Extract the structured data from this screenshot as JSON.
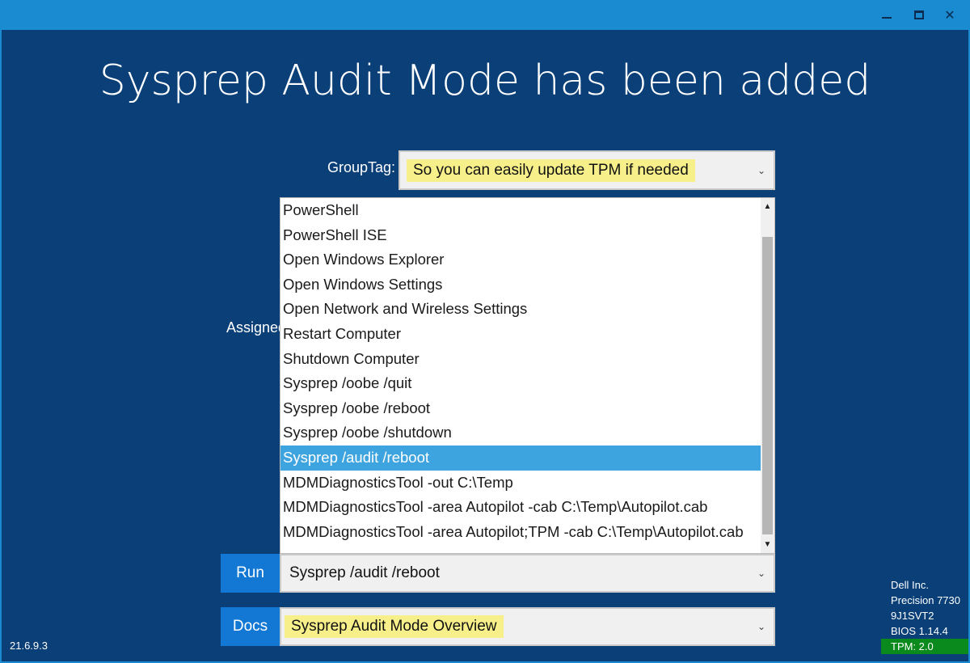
{
  "window": {
    "controls": [
      "minimize",
      "maximize",
      "close"
    ],
    "close_glyph": "✕"
  },
  "heading": "Sysprep Audit Mode has been added",
  "group_tag": {
    "label": "GroupTag:",
    "value": "So you can easily update TPM if needed"
  },
  "assigned_label_partial": "Assigned",
  "dropdown_list": {
    "items": [
      "PowerShell",
      "PowerShell ISE",
      "Open Windows Explorer",
      "Open Windows Settings",
      "Open Network and Wireless Settings",
      "Restart Computer",
      "Shutdown Computer",
      "Sysprep /oobe /quit",
      "Sysprep /oobe /reboot",
      "Sysprep /oobe /shutdown",
      "Sysprep /audit /reboot",
      "MDMDiagnosticsTool -out C:\\Temp",
      "MDMDiagnosticsTool -area Autopilot -cab C:\\Temp\\Autopilot.cab",
      "MDMDiagnosticsTool -area Autopilot;TPM -cab C:\\Temp\\Autopilot.cab"
    ],
    "selected_index": 10
  },
  "run": {
    "button_label": "Run",
    "combo_value": "Sysprep /audit /reboot"
  },
  "docs": {
    "button_label": "Docs",
    "combo_value": "Sysprep Audit Mode Overview"
  },
  "version": "21.6.9.3",
  "system_info": {
    "manufacturer": "Dell Inc.",
    "model": "Precision 7730",
    "serial": "9J1SVT2",
    "bios": "BIOS 1.14.4",
    "tpm": "TPM: 2.0"
  },
  "colors": {
    "background": "#0a3f78",
    "titlebar": "#1a8bd0",
    "button": "#1278d4",
    "selection": "#3ea4e0",
    "highlight": "#f7ef8a",
    "tpm_badge": "#0a8a1c"
  }
}
